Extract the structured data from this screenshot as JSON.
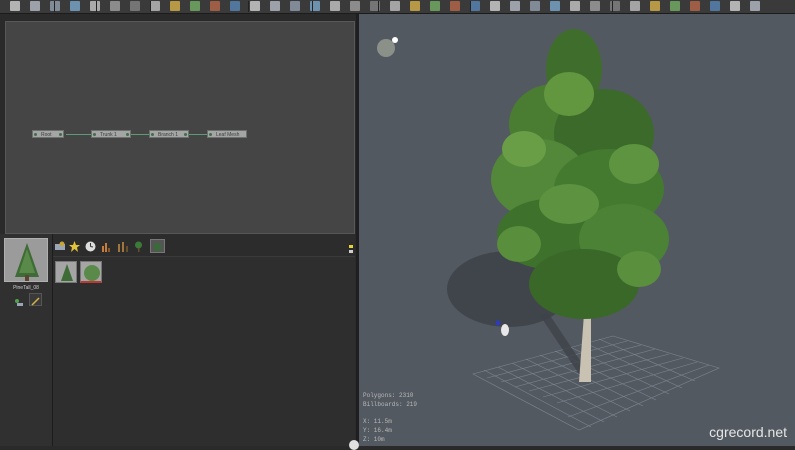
{
  "toolbar": {
    "icons": [
      "new-file-icon",
      "open-icon",
      "save-icon",
      "undo-icon",
      "redo-icon",
      "cut-icon",
      "copy-icon",
      "paste-icon",
      "delete-icon",
      "lock-icon",
      "settings-icon",
      "square-icon",
      "close-icon",
      "add-node-icon",
      "branch-icon",
      "grid-icon",
      "pencil-icon",
      "brush-icon",
      "select-icon",
      "paint-icon",
      "panel-icon",
      "leaf-tool-icon",
      "pipe-icon",
      "bar-icon",
      "dial-icon",
      "star-icon",
      "wind-icon",
      "camera-icon",
      "lasso-icon",
      "node-icon",
      "anchor-icon",
      "leaf-icon",
      "frond-icon",
      "branch-tool-icon",
      "mesh-icon",
      "display-icon",
      "screen-icon",
      "globe-icon"
    ]
  },
  "node_graph": {
    "nodes": [
      "Root",
      "Trunk 1",
      "Branch 1",
      "Leaf Mesh"
    ]
  },
  "species": {
    "label": "PineTall_08"
  },
  "assets": {
    "toolbar_icons": [
      "materials-icon",
      "star-icon",
      "clock-icon",
      "chart-icon",
      "lod-icon",
      "tree-icon",
      "image-icon"
    ]
  },
  "viewport": {
    "stats": [
      "Polygons: 2310",
      "Billboards: 219",
      "X: 11.5m",
      "Y: 16.4m",
      "Z: 10m"
    ],
    "light_icon": "light-sphere-icon"
  },
  "watermark": "cgrecord.net",
  "colors": {
    "viewport_bg": "#535961",
    "panel_bg": "#454545",
    "node_fill": "#a4a6a6",
    "wire": "#5c9a7a"
  }
}
